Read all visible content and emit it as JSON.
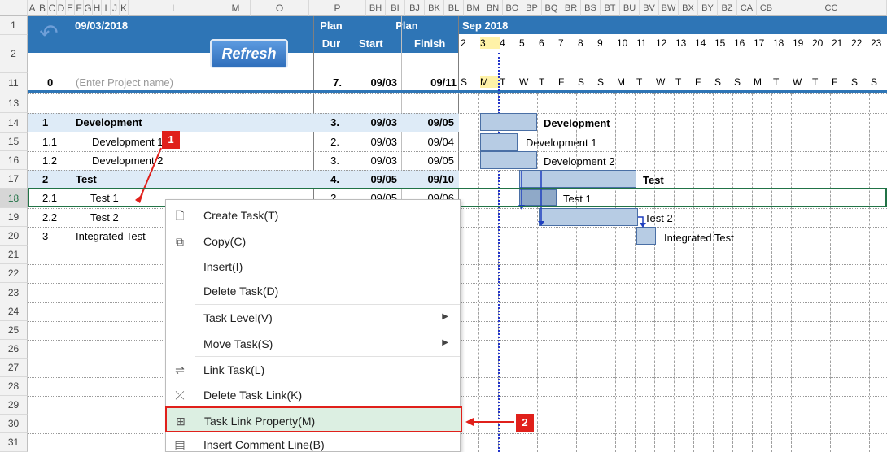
{
  "column_headers": [
    "",
    "A",
    "B",
    "C",
    "D",
    "E",
    "F",
    "G",
    "H",
    "I",
    "J",
    "K",
    "L",
    "M",
    "O",
    "P",
    "BH",
    "BI",
    "BJ",
    "BK",
    "BL",
    "BM",
    "BN",
    "BO",
    "BP",
    "BQ",
    "BR",
    "BS",
    "BT",
    "BU",
    "BV",
    "BW",
    "BX",
    "BY",
    "BZ",
    "CA",
    "CB",
    "CC"
  ],
  "header": {
    "date": "09/03/2018",
    "refresh_button": "Refresh",
    "plan_dur_top": "Plan",
    "plan_dur_bottom": "Dur",
    "plan_top": "Plan",
    "start": "Start",
    "finish": "Finish",
    "month": "Sep 2018",
    "days": [
      "2",
      "3",
      "4",
      "5",
      "6",
      "7",
      "8",
      "9",
      "10",
      "11",
      "12",
      "13",
      "14",
      "15",
      "16",
      "17",
      "18",
      "19",
      "20",
      "21",
      "22",
      "23"
    ],
    "weekdays": [
      "S",
      "M",
      "T",
      "W",
      "T",
      "F",
      "S",
      "S",
      "M",
      "T",
      "W",
      "T",
      "F",
      "S",
      "S",
      "M",
      "T",
      "W",
      "T",
      "F",
      "S",
      "S"
    ]
  },
  "row_numbers": [
    "1",
    "2",
    "11",
    "13",
    "14",
    "15",
    "16",
    "17",
    "18",
    "19",
    "20",
    "21",
    "22",
    "23",
    "24",
    "25",
    "26",
    "27",
    "28",
    "29",
    "30",
    "31"
  ],
  "project_row": {
    "id": "0",
    "name": "(Enter Project name)",
    "dur": "7.",
    "start": "09/03",
    "finish": "09/11"
  },
  "tasks": [
    {
      "id": "1",
      "name": "Development",
      "dur": "3.",
      "start": "09/03",
      "finish": "09/05",
      "summary": true
    },
    {
      "id": "1.1",
      "name": "Development 1",
      "dur": "2.",
      "start": "09/03",
      "finish": "09/04",
      "summary": false
    },
    {
      "id": "1.2",
      "name": "Development 2",
      "dur": "3.",
      "start": "09/03",
      "finish": "09/05",
      "summary": false
    },
    {
      "id": "2",
      "name": "Test",
      "dur": "4.",
      "start": "09/05",
      "finish": "09/10",
      "summary": true
    },
    {
      "id": "2.1",
      "name": "Test 1",
      "dur": "2.",
      "start": "09/05",
      "finish": "09/06",
      "summary": false
    },
    {
      "id": "2.2",
      "name": "Test 2",
      "dur": "",
      "start": "",
      "finish": "",
      "summary": false
    },
    {
      "id": "3",
      "name": "Integrated Test",
      "dur": "",
      "start": "",
      "finish": "",
      "summary": false
    }
  ],
  "gantt_labels": {
    "development": "Development",
    "development1": "Development 1",
    "development2": "Development 2",
    "test": "Test",
    "test1": "Test 1",
    "test2": "Test 2",
    "integrated_test": "Integrated Test"
  },
  "context_menu": {
    "items": [
      {
        "label": "Create Task(T)",
        "icon": "new-page-icon"
      },
      {
        "label": "Copy(C)",
        "icon": "copy-icon"
      },
      {
        "label": "Insert(I)",
        "icon": ""
      },
      {
        "label": "Delete Task(D)",
        "icon": ""
      },
      {
        "label": "Task Level(V)",
        "icon": "",
        "submenu": true
      },
      {
        "label": "Move Task(S)",
        "icon": "",
        "submenu": true
      },
      {
        "label": "Link Task(L)",
        "icon": "link-icon"
      },
      {
        "label": "Delete Task Link(K)",
        "icon": "unlink-icon"
      },
      {
        "label": "Task Link Property(M)",
        "icon": "link-property-icon",
        "highlighted": true
      },
      {
        "label": "Insert Comment Line(B)",
        "icon": "comment-line-icon"
      }
    ]
  },
  "callouts": [
    "1",
    "2"
  ],
  "colors": {
    "header_blue": "#2e75b6",
    "accent_red": "#e0201b",
    "bar_fill": "#b7cce4",
    "summary_row": "#deebf7",
    "today_line": "#2234c9"
  }
}
